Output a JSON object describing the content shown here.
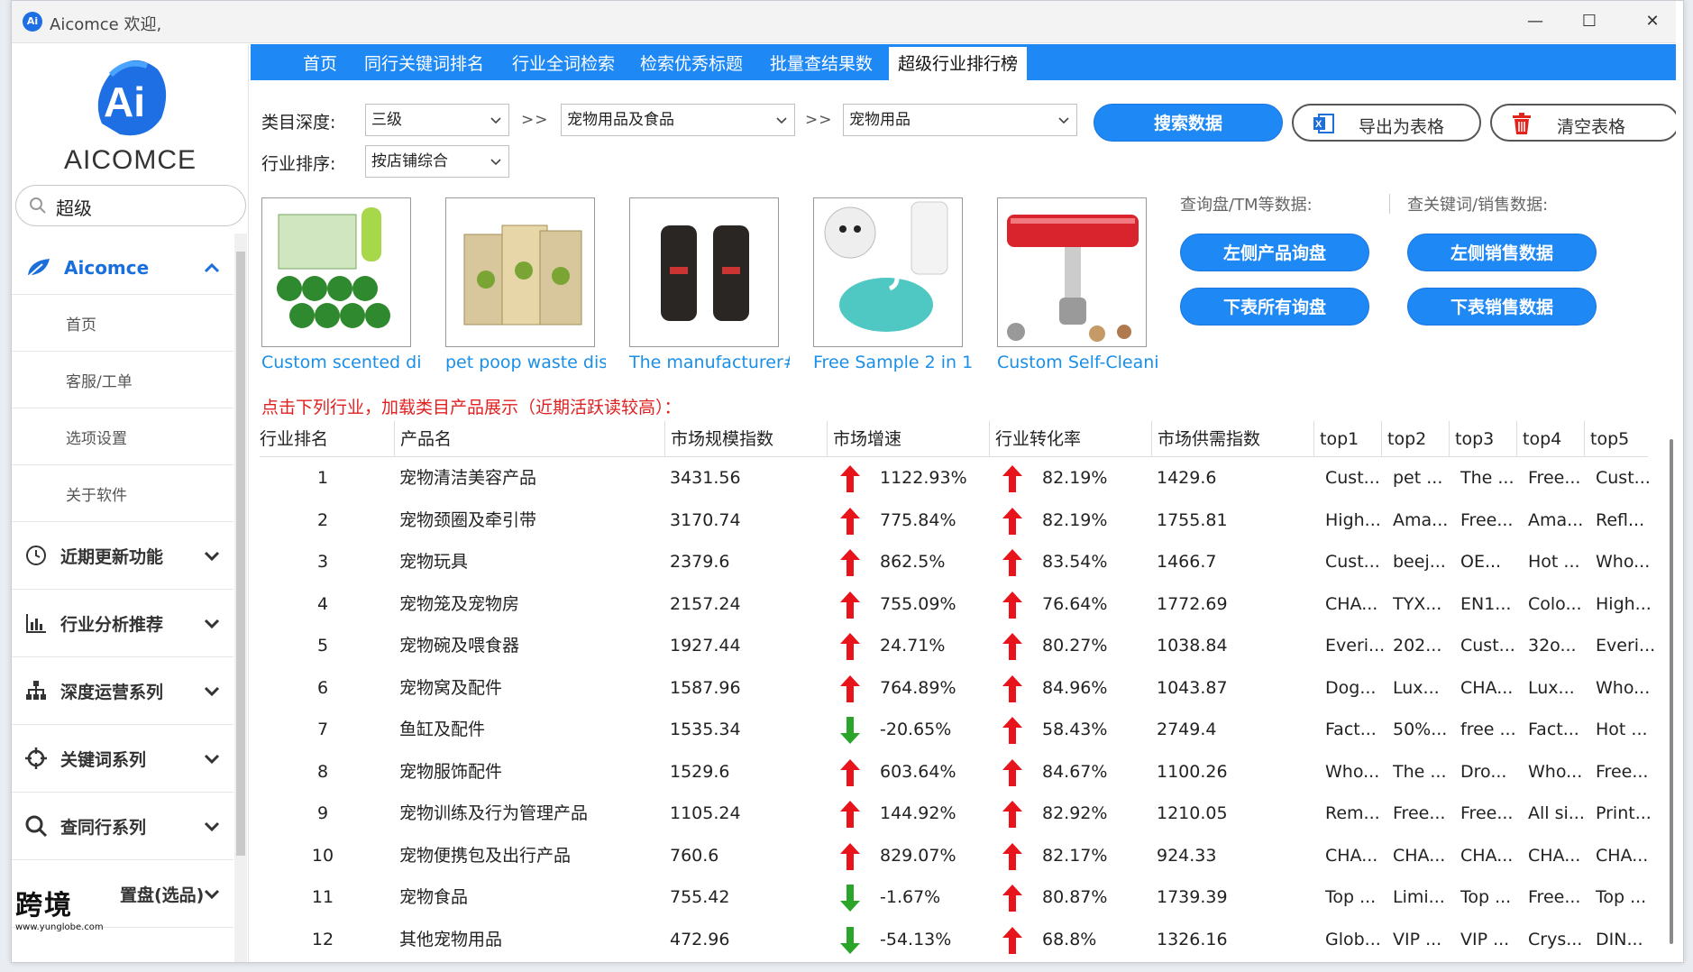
{
  "window": {
    "title": "Aicomce 欢迎,",
    "app_icon_text": "Ai",
    "minimize": "—",
    "maximize": "☐",
    "close": "✕"
  },
  "sidebar": {
    "logo_text": "AICOMCE",
    "search_value": "超级",
    "group": {
      "label": "Aicomce"
    },
    "sub_items": [
      "首页",
      "客服/工单",
      "选项设置",
      "关于软件"
    ],
    "items": [
      {
        "label": "近期更新功能",
        "icon": "clock-icon"
      },
      {
        "label": "行业分析推荐",
        "icon": "bar-chart-icon"
      },
      {
        "label": "深度运营系列",
        "icon": "org-chart-icon"
      },
      {
        "label": "关键词系列",
        "icon": "crosshair-icon"
      },
      {
        "label": "查同行系列",
        "icon": "search-icon"
      },
      {
        "label": "置盘(选品)",
        "icon": ""
      }
    ],
    "watermark": {
      "line1": "跨境",
      "line2": "www.yunglobe.com"
    }
  },
  "tabs": [
    {
      "label": "首页",
      "active": false
    },
    {
      "label": "同行关键词排名",
      "active": false
    },
    {
      "label": "行业全词检索",
      "active": false
    },
    {
      "label": "检索优秀标题",
      "active": false
    },
    {
      "label": "批量查结果数",
      "active": false
    },
    {
      "label": "超级行业排行榜",
      "active": true
    }
  ],
  "filters": {
    "depth_label": "类目深度:",
    "depth_value": "三级",
    "sep1": ">>",
    "cat1_value": "宠物用品及食品",
    "sep2": ">>",
    "cat2_value": "宠物用品",
    "sort_label": "行业排序:",
    "sort_value": "按店铺综合",
    "search_btn": "搜索数据",
    "export_btn": "导出为表格",
    "clear_btn": "清空表格"
  },
  "products": [
    {
      "caption": "Custom scented dis"
    },
    {
      "caption": "pet poop waste disp"
    },
    {
      "caption": "The manufacturer#"
    },
    {
      "caption": "Free Sample 2 in 1 |"
    },
    {
      "caption": "Custom Self-Cleanin"
    }
  ],
  "query_panel": {
    "group1_label": "查询盘/TM等数据:",
    "group2_label": "查关键词/销售数据:",
    "btn_left_inquiry": "左侧产品询盘",
    "btn_all_inquiry": "下表所有询盘",
    "btn_left_sales": "左侧销售数据",
    "btn_all_sales": "下表销售数据"
  },
  "hint": "点击下列行业，加载类目产品展示（近期活跃读较高）：",
  "table": {
    "headers": [
      "行业排名",
      "产品名",
      "市场规模指数",
      "市场增速",
      "行业转化率",
      "市场供需指数",
      "top1",
      "top2",
      "top3",
      "top4",
      "top5"
    ],
    "rows": [
      {
        "rank": "1",
        "name": "宠物清洁美容产品",
        "scale": "3431.56",
        "growth_dir": "up",
        "growth": "1122.93%",
        "conv_dir": "up",
        "conv": "82.19%",
        "supply": "1429.6",
        "top": [
          "Cust...",
          "pet ...",
          "The ...",
          "Free...",
          "Cust..."
        ]
      },
      {
        "rank": "2",
        "name": "宠物颈圈及牵引带",
        "scale": "3170.74",
        "growth_dir": "up",
        "growth": "775.84%",
        "conv_dir": "up",
        "conv": "82.19%",
        "supply": "1755.81",
        "top": [
          "High...",
          "Ama...",
          "Free...",
          "Ama...",
          "Refl..."
        ]
      },
      {
        "rank": "3",
        "name": "宠物玩具",
        "scale": "2379.6",
        "growth_dir": "up",
        "growth": "862.5%",
        "conv_dir": "up",
        "conv": "83.54%",
        "supply": "1466.7",
        "top": [
          "Cust...",
          "beej...",
          "OE...",
          "Hot ...",
          "Who..."
        ]
      },
      {
        "rank": "4",
        "name": "宠物笼及宠物房",
        "scale": "2157.24",
        "growth_dir": "up",
        "growth": "755.09%",
        "conv_dir": "up",
        "conv": "76.64%",
        "supply": "1772.69",
        "top": [
          "CHA...",
          "TYX...",
          "EN1...",
          "Colo...",
          "High..."
        ]
      },
      {
        "rank": "5",
        "name": "宠物碗及喂食器",
        "scale": "1927.44",
        "growth_dir": "up",
        "growth": "24.71%",
        "conv_dir": "up",
        "conv": "80.27%",
        "supply": "1038.84",
        "top": [
          "Everi...",
          "202...",
          "Cust...",
          "32o...",
          "Everi..."
        ]
      },
      {
        "rank": "6",
        "name": "宠物窝及配件",
        "scale": "1587.96",
        "growth_dir": "up",
        "growth": "764.89%",
        "conv_dir": "up",
        "conv": "84.96%",
        "supply": "1043.87",
        "top": [
          "Dog...",
          "Lux...",
          "CHA...",
          "Lux...",
          "Who..."
        ]
      },
      {
        "rank": "7",
        "name": "鱼缸及配件",
        "scale": "1535.34",
        "growth_dir": "down",
        "growth": "-20.65%",
        "conv_dir": "up",
        "conv": "58.43%",
        "supply": "2749.4",
        "top": [
          "Fact...",
          "50%...",
          "free ...",
          "Fact...",
          "Hot ..."
        ]
      },
      {
        "rank": "8",
        "name": "宠物服饰配件",
        "scale": "1529.6",
        "growth_dir": "up",
        "growth": "603.64%",
        "conv_dir": "up",
        "conv": "84.67%",
        "supply": "1100.26",
        "top": [
          "Who...",
          "The ...",
          "Dro...",
          "Who...",
          "Free..."
        ]
      },
      {
        "rank": "9",
        "name": "宠物训练及行为管理产品",
        "scale": "1105.24",
        "growth_dir": "up",
        "growth": "144.92%",
        "conv_dir": "up",
        "conv": "82.92%",
        "supply": "1210.05",
        "top": [
          "Rem...",
          "Free...",
          "Free...",
          "All si...",
          "Print..."
        ]
      },
      {
        "rank": "10",
        "name": "宠物便携包及出行产品",
        "scale": "760.6",
        "growth_dir": "up",
        "growth": "829.07%",
        "conv_dir": "up",
        "conv": "82.17%",
        "supply": "924.33",
        "top": [
          "CHA...",
          "CHA...",
          "CHA...",
          "CHA...",
          "CHA..."
        ]
      },
      {
        "rank": "11",
        "name": "宠物食品",
        "scale": "755.42",
        "growth_dir": "down",
        "growth": "-1.67%",
        "conv_dir": "up",
        "conv": "80.87%",
        "supply": "1739.39",
        "top": [
          "Top ...",
          "Limi...",
          "Top ...",
          "Free...",
          "Top ..."
        ]
      },
      {
        "rank": "12",
        "name": "其他宠物用品",
        "scale": "472.96",
        "growth_dir": "down",
        "growth": "-54.13%",
        "conv_dir": "up",
        "conv": "68.8%",
        "supply": "1326.16",
        "top": [
          "Glob...",
          "VIP ...",
          "VIP ...",
          "Crys...",
          "DIN..."
        ]
      }
    ]
  },
  "colors": {
    "accent": "#1e88f5",
    "up": "#e8141c",
    "down": "#2aa52a",
    "link": "#1a8fe8",
    "hint": "#e02020"
  }
}
